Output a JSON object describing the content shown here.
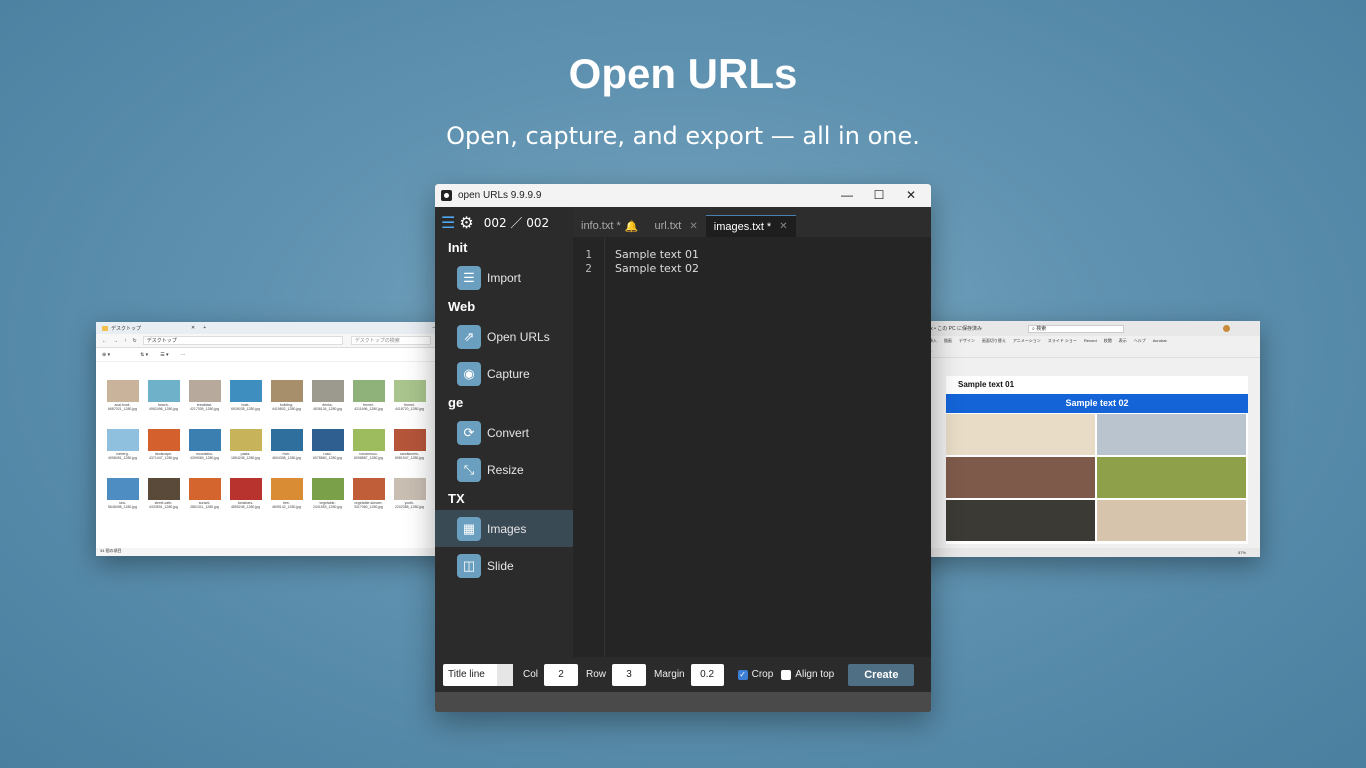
{
  "hero": {
    "title": "Open URLs",
    "subtitle": "Open, capture, and export — all in one."
  },
  "app": {
    "window_title": "open URLs 9.9.9.9",
    "counter": "002 ／ 002",
    "sidebar": [
      {
        "type": "section",
        "label": "Init"
      },
      {
        "type": "item",
        "label": "Import",
        "icon": "document-icon"
      },
      {
        "type": "section",
        "label": "Web"
      },
      {
        "type": "item",
        "label": "Open URLs",
        "icon": "link-icon"
      },
      {
        "type": "item",
        "label": "Capture",
        "icon": "camera-icon"
      },
      {
        "type": "section",
        "label": "ge"
      },
      {
        "type": "item",
        "label": "Convert",
        "icon": "convert-icon"
      },
      {
        "type": "item",
        "label": "Resize",
        "icon": "resize-icon"
      },
      {
        "type": "section",
        "label": "TX"
      },
      {
        "type": "item",
        "label": "Images",
        "icon": "images-icon",
        "active": true
      },
      {
        "type": "item",
        "label": "Slide",
        "icon": "slide-icon"
      }
    ],
    "tabs": [
      {
        "label": "info.txt *",
        "badge": "🔔",
        "active": false,
        "closable": false
      },
      {
        "label": "url.txt",
        "active": false,
        "closable": true
      },
      {
        "label": "images.txt *",
        "active": true,
        "closable": true
      }
    ],
    "lines": [
      "Sample text 01",
      "Sample text 02"
    ],
    "line_numbers": [
      "1",
      "2"
    ],
    "bottom": {
      "title_line": "Title line",
      "col_label": "Col",
      "col_value": "2",
      "row_label": "Row",
      "row_value": "3",
      "margin_label": "Margin",
      "margin_value": "0.2",
      "crop_label": "Crop",
      "crop_checked": true,
      "align_label": "Align top",
      "align_checked": false,
      "create_label": "Create"
    },
    "accent_color": "#4ea6f0"
  },
  "explorer": {
    "tab_title": "デスクトップ",
    "address": "デスクトップ",
    "search_placeholder": "デスクトップの検索",
    "status": "34 個の項目",
    "files": [
      {
        "name": "acai-bowl-6687021_1280.jpg",
        "color": "#c9b39a"
      },
      {
        "name": "beach-4962496_1280.jpg",
        "color": "#6fb1c9"
      },
      {
        "name": "breakfast-4217305_1280.jpg",
        "color": "#b7aa9c"
      },
      {
        "name": "boat-6926035_1280.jpg",
        "color": "#3e8fbf"
      },
      {
        "name": "building-4419802_1280.jpg",
        "color": "#a88f6c"
      },
      {
        "name": "drinks-4636134_1280.jpg",
        "color": "#9c9a8e"
      },
      {
        "name": "fennel-4211696_1280.jpg",
        "color": "#8fb27a"
      },
      {
        "name": "fennel-4418720_1280.jpg",
        "color": "#a9c48d"
      },
      {
        "name": "iceberg-4998451_1280.jpg",
        "color": "#8fc0dd"
      },
      {
        "name": "landscape-4371447_1280.jpg",
        "color": "#d4602e"
      },
      {
        "name": "mountains-4399069_1280.jpg",
        "color": "#3a7fb0"
      },
      {
        "name": "pasta-1854245_1280.jpg",
        "color": "#c7b35a"
      },
      {
        "name": "river-4604398_1280.jpg",
        "color": "#2f6f9e"
      },
      {
        "name": "road-6078860_1280.jpg",
        "color": "#2f5f91"
      },
      {
        "name": "romanesco-6098887_1280.jpg",
        "color": "#9cbc5e"
      },
      {
        "name": "sandstones-5981947_1280.jpg",
        "color": "#b5553a"
      },
      {
        "name": "sea-5648498_1280.jpg",
        "color": "#4d8dc2"
      },
      {
        "name": "street-cafe-4433591_1280.jpg",
        "color": "#5a4a3a"
      },
      {
        "name": "sunset-2861311_1280.jpg",
        "color": "#d4652e"
      },
      {
        "name": "tomatoes-4855245_1280.jpg",
        "color": "#b8322e"
      },
      {
        "name": "tree-4695142_1280.jpg",
        "color": "#d98c34"
      },
      {
        "name": "vegetable-2441553_1280.jpg",
        "color": "#7aa04a"
      },
      {
        "name": "vegetable-skewer-3317060_1280.jpg",
        "color": "#c05e3a"
      },
      {
        "name": "youth-2202358_1280.jpg",
        "color": "#c8beb2"
      }
    ]
  },
  "ppt": {
    "title": "_images.pptx • この PC に保存済み",
    "search": "検索",
    "menu": [
      "ファイル",
      "ホーム",
      "挿入",
      "描画",
      "デザイン",
      "画面切り替え",
      "アニメーション",
      "スライド ショー",
      "Record",
      "校閲",
      "表示",
      "ヘルプ",
      "Acrobat"
    ],
    "slide_count": [
      "1",
      "2",
      "3",
      "4",
      "5",
      "6",
      "7",
      "8"
    ],
    "slide_text_1": "Sample text 01",
    "slide_text_2": "Sample text 02",
    "status": "スライド 4/8",
    "zoom": "57%",
    "banner_color": "#1464d8",
    "photos": [
      {
        "color": "#e9dcc7"
      },
      {
        "color": "#b9c4cf"
      },
      {
        "color": "#7e5a4a"
      },
      {
        "color": "#8fa04a"
      },
      {
        "color": "#3c3a34"
      },
      {
        "color": "#d6c4ac"
      }
    ]
  }
}
